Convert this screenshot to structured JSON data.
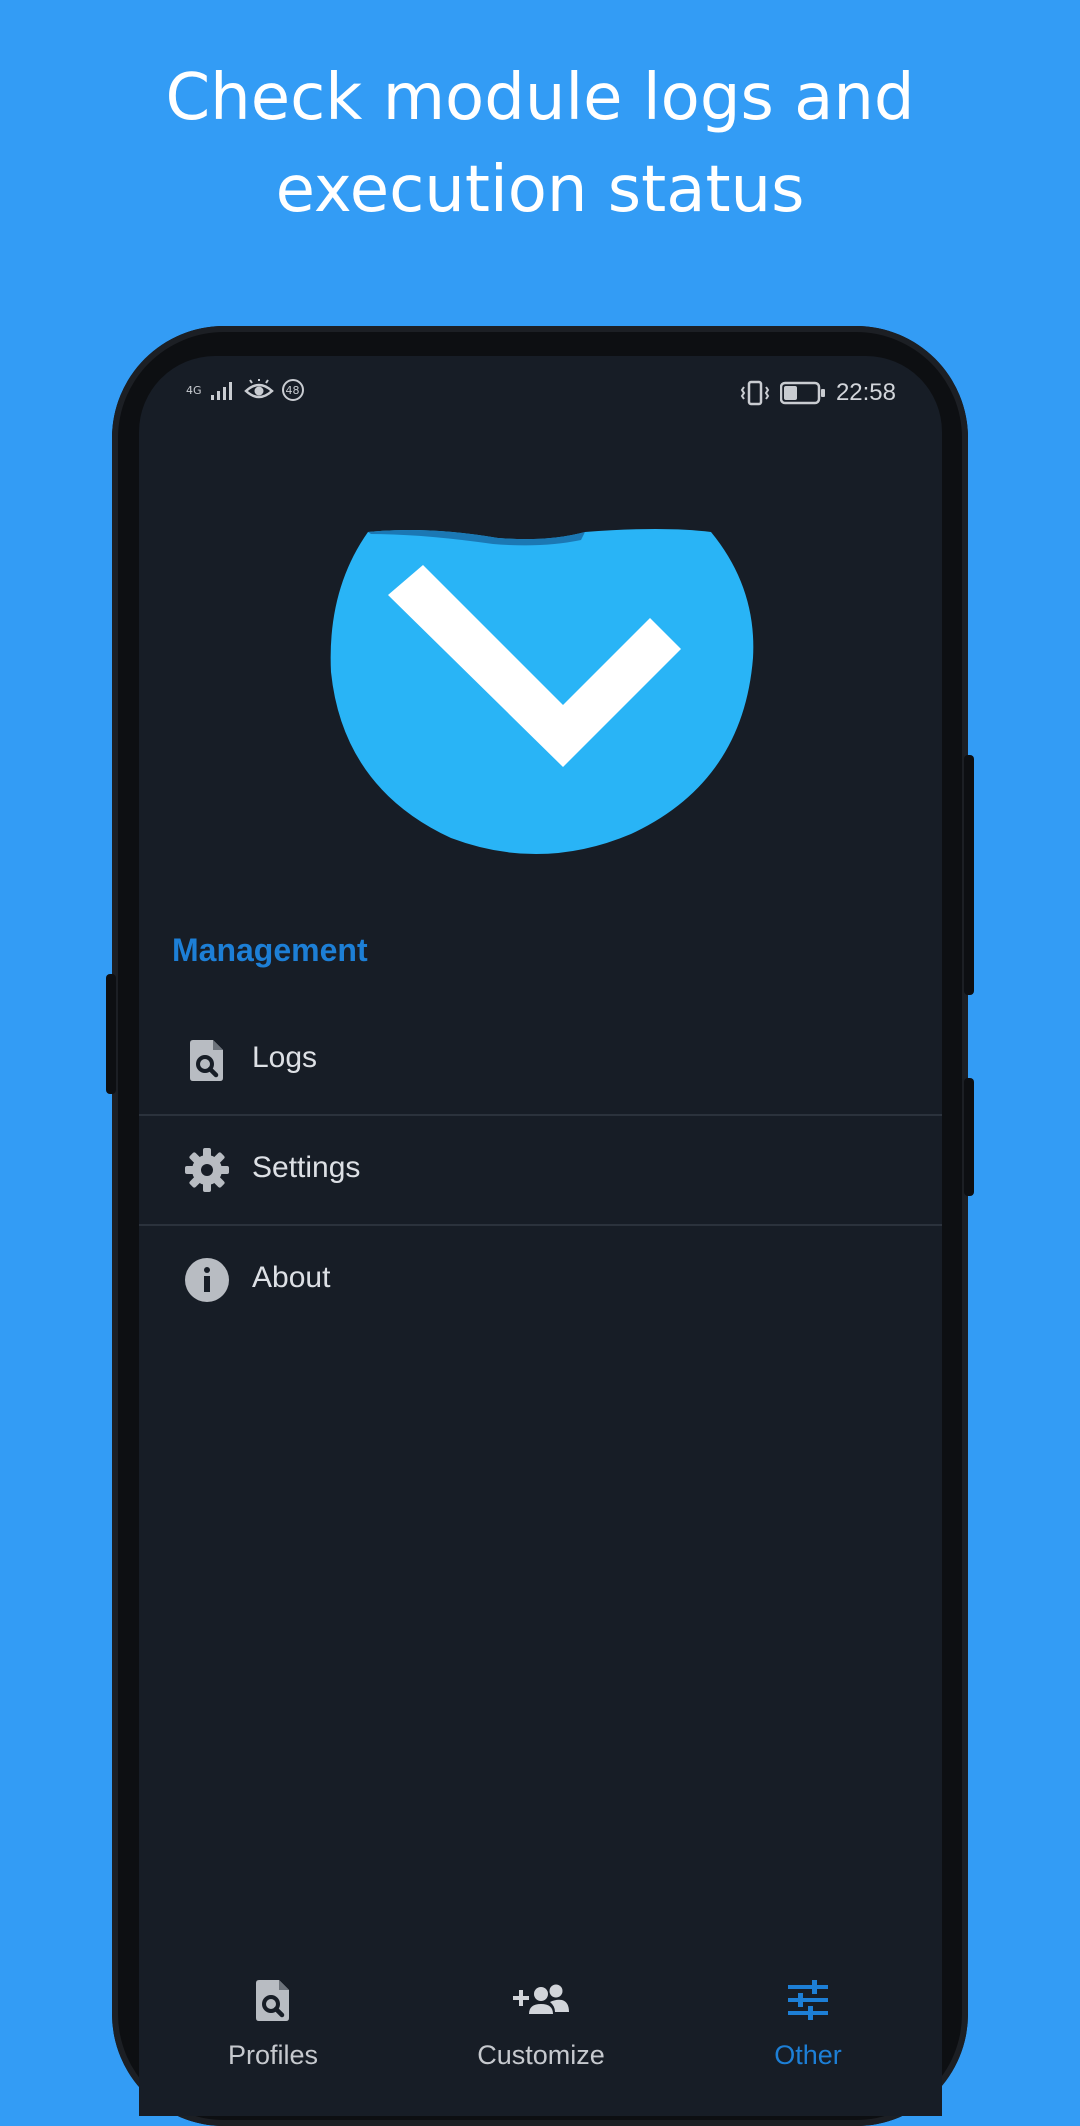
{
  "headline": {
    "line1": "Check module logs and",
    "line2": "execution status"
  },
  "status_bar": {
    "network_label": "4G",
    "notification_count": "48",
    "time": "22:58",
    "battery_level": 0.4
  },
  "colors": {
    "background": "#339cf5",
    "screen": "#171d26",
    "accent": "#1d7fd6",
    "logo": "#29b4f6"
  },
  "logo": {
    "icon": "checkmark-logo-icon"
  },
  "section": {
    "title": "Management"
  },
  "menu": {
    "items": [
      {
        "label": "Logs",
        "icon": "file-search-icon"
      },
      {
        "label": "Settings",
        "icon": "gear-icon"
      },
      {
        "label": "About",
        "icon": "info-icon"
      }
    ]
  },
  "bottom_nav": {
    "items": [
      {
        "label": "Profiles",
        "icon": "file-search-icon",
        "active": false
      },
      {
        "label": "Customize",
        "icon": "add-group-icon",
        "active": false
      },
      {
        "label": "Other",
        "icon": "sliders-icon",
        "active": true
      }
    ]
  }
}
